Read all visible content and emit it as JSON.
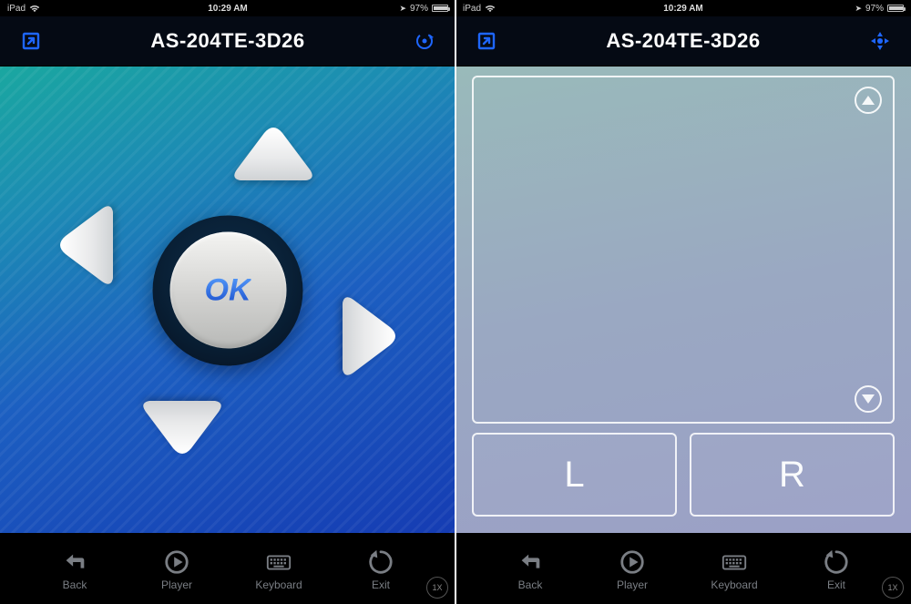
{
  "status": {
    "device": "iPad",
    "time": "10:29 AM",
    "battery_text": "97%",
    "location_icon": "location-icon"
  },
  "header": {
    "title": "AS-204TE-3D26"
  },
  "dpad": {
    "ok_label": "OK"
  },
  "touchpad": {
    "left_label": "L",
    "right_label": "R"
  },
  "toolbar": {
    "back": "Back",
    "player": "Player",
    "keyboard": "Keyboard",
    "exit": "Exit"
  },
  "zoom": {
    "label": "1X"
  }
}
